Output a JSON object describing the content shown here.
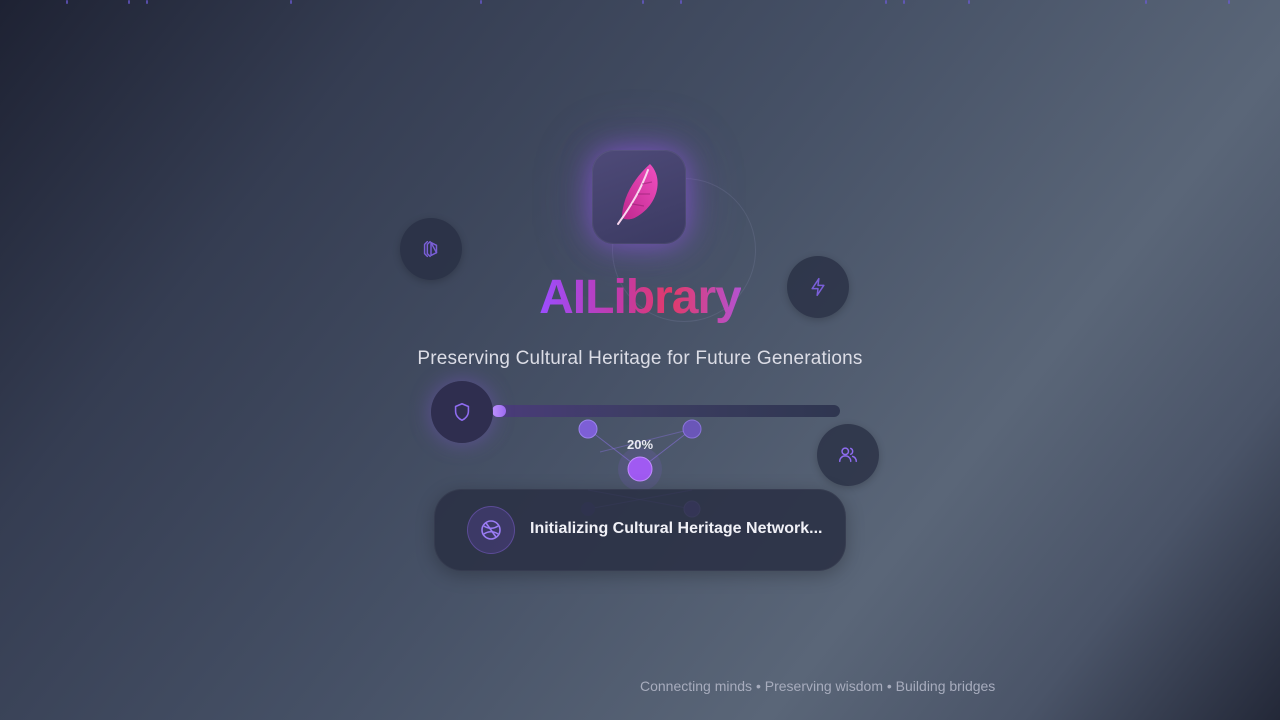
{
  "app": {
    "brand": "AILibrary",
    "tagline": "Preserving Cultural Heritage for Future Generations",
    "logo_icon": "feather-icon"
  },
  "loading": {
    "progress_percent": 20,
    "progress_label": "20%",
    "status_text": "Initializing Cultural Heritage Network...",
    "status_icon": "globe-icon"
  },
  "floating_icons": [
    "layers-icon",
    "lightning-icon",
    "shield-icon",
    "users-icon"
  ],
  "footer": {
    "text": "Connecting minds • Preserving wisdom • Building bridges"
  },
  "colors": {
    "accent": "#9b5cf6",
    "brand_gradient_start": "#9b4dff",
    "brand_gradient_end": "#e13a6a"
  }
}
